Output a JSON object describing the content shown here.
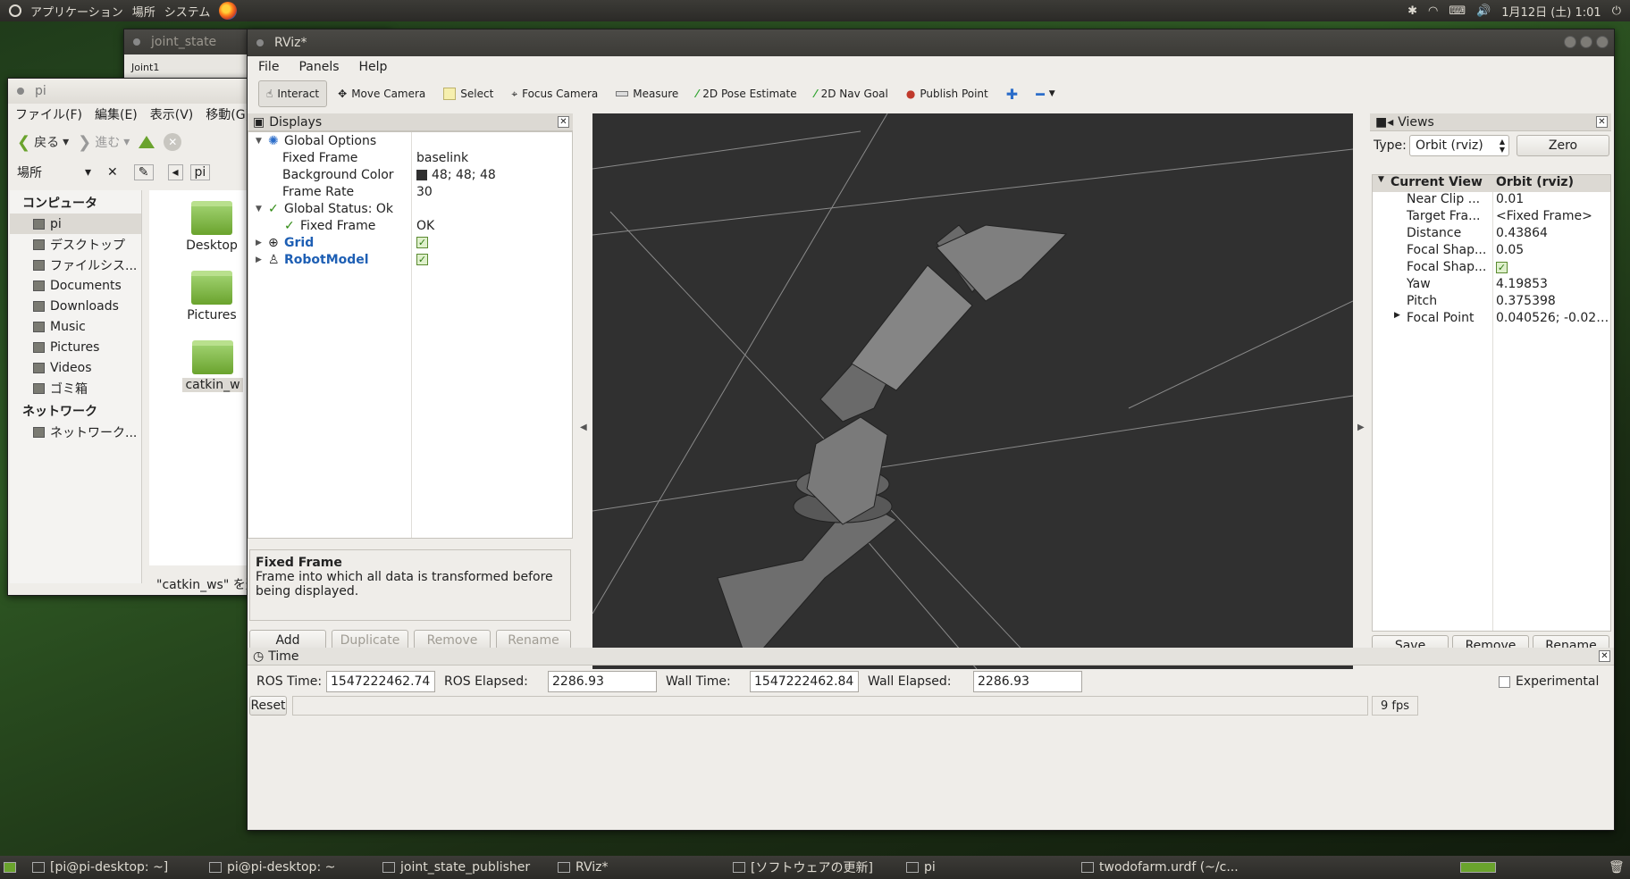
{
  "top_panel": {
    "menu": [
      "アプリケーション",
      "場所",
      "システム"
    ],
    "clock": "1月12日 (土) 1:01"
  },
  "joint_window": {
    "title": "joint_state",
    "label": "Joint1"
  },
  "files_window": {
    "title": "pi",
    "menu": [
      "ファイル(F)",
      "編集(E)",
      "表示(V)",
      "移動(G)"
    ],
    "back_label": "戻る",
    "forward_label": "進む",
    "places_label": "場所",
    "path_button": "pi",
    "sidebar": {
      "computer_header": "コンピュータ",
      "computer_items": [
        "pi",
        "デスクトップ",
        "ファイルシス...",
        "Documents",
        "Downloads",
        "Music",
        "Pictures",
        "Videos",
        "ゴミ箱"
      ],
      "network_header": "ネットワーク",
      "network_items": [
        "ネットワーク..."
      ]
    },
    "folders": [
      "Desktop",
      "Pictures",
      "catkin_w"
    ],
    "status": "\"catkin_ws\" を選"
  },
  "rviz": {
    "title": "RViz*",
    "menu": [
      "File",
      "Panels",
      "Help"
    ],
    "toolbar": [
      "Interact",
      "Move Camera",
      "Select",
      "Focus Camera",
      "Measure",
      "2D Pose Estimate",
      "2D Nav Goal",
      "Publish Point"
    ],
    "displays": {
      "title": "Displays",
      "global_options": "Global Options",
      "fixed_frame_key": "Fixed Frame",
      "fixed_frame_val": "baselink",
      "bg_color_key": "Background Color",
      "bg_color_val": "48; 48; 48",
      "bg_color_hex": "#303030",
      "frame_rate_key": "Frame Rate",
      "frame_rate_val": "30",
      "global_status": "Global Status: Ok",
      "status_fixed_frame_key": "Fixed Frame",
      "status_fixed_frame_val": "OK",
      "grid": "Grid",
      "robot_model": "RobotModel",
      "desc_title": "Fixed Frame",
      "desc_text": "Frame into which all data is transformed before being displayed.",
      "buttons": [
        "Add",
        "Duplicate",
        "Remove",
        "Rename"
      ]
    },
    "views": {
      "title": "Views",
      "type_label": "Type:",
      "type_value": "Orbit (rviz)",
      "zero_button": "Zero",
      "header_key": "Current View",
      "header_val": "Orbit (rviz)",
      "rows": [
        {
          "k": "Near Clip ...",
          "v": "0.01"
        },
        {
          "k": "Target Fra...",
          "v": "<Fixed Frame>"
        },
        {
          "k": "Distance",
          "v": "0.43864"
        },
        {
          "k": "Focal Shap...",
          "v": "0.05"
        },
        {
          "k": "Focal Shap...",
          "v": ""
        },
        {
          "k": "Yaw",
          "v": "4.19853"
        },
        {
          "k": "Pitch",
          "v": "0.375398"
        },
        {
          "k": "Focal Point",
          "v": "0.040526; -0.021..."
        }
      ],
      "buttons": [
        "Save",
        "Remove",
        "Rename"
      ]
    },
    "time": {
      "title": "Time",
      "ros_time_label": "ROS Time:",
      "ros_time": "1547222462.74",
      "ros_elapsed_label": "ROS Elapsed:",
      "ros_elapsed": "2286.93",
      "wall_time_label": "Wall Time:",
      "wall_time": "1547222462.84",
      "wall_elapsed_label": "Wall Elapsed:",
      "wall_elapsed": "2286.93",
      "experimental": "Experimental",
      "reset": "Reset",
      "fps": "9 fps"
    }
  },
  "taskbar": [
    "[pi@pi-desktop: ~]",
    "pi@pi-desktop: ~",
    "joint_state_publisher",
    "RViz*",
    "[ソフトウェアの更新]",
    "pi",
    "twodofarm.urdf (~/c..."
  ]
}
